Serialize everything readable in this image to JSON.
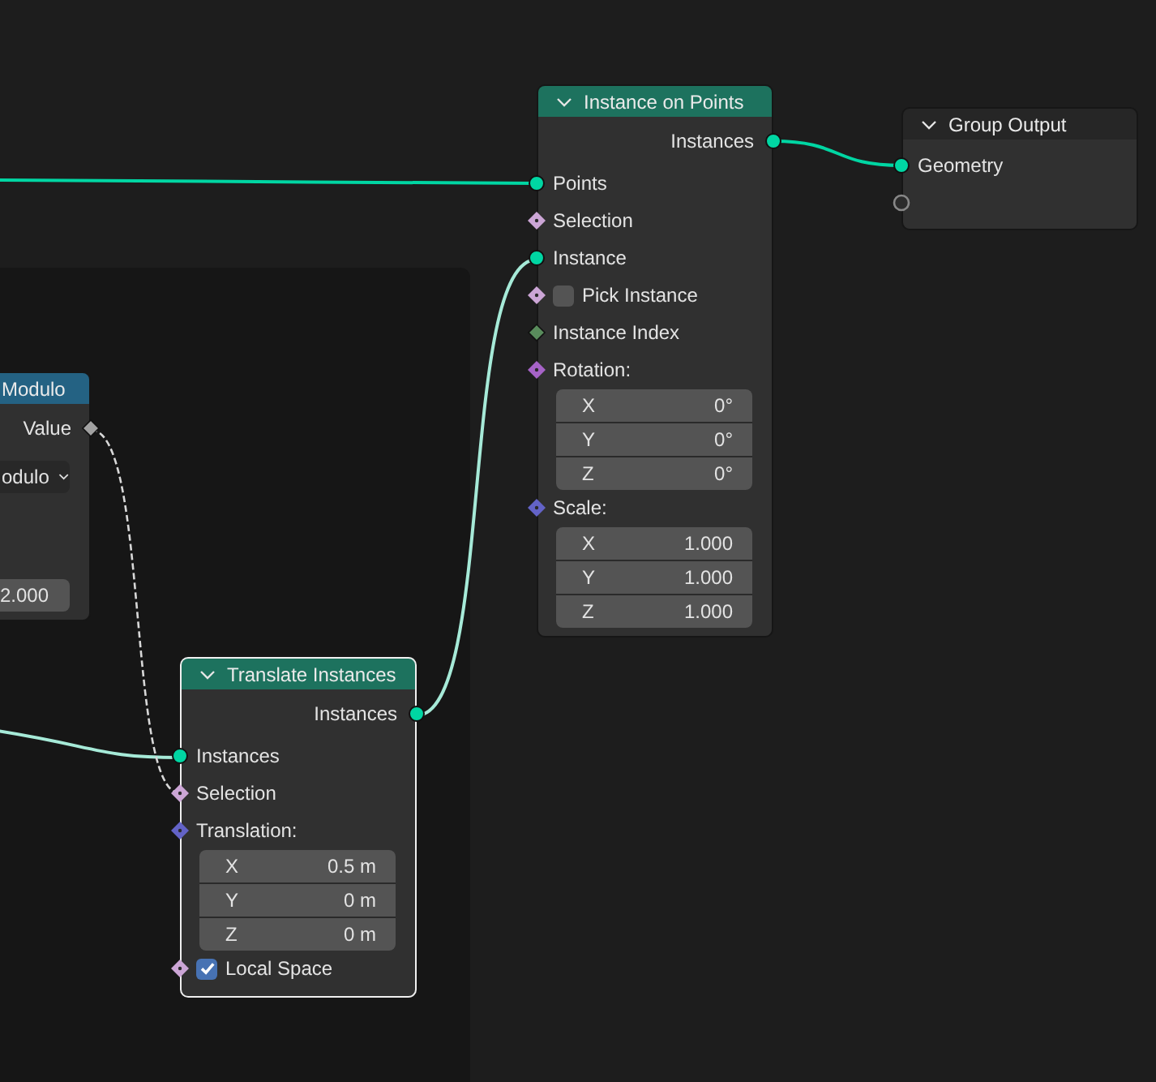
{
  "nodes": [
    {
      "title": "Instance on Points",
      "kind": "geometry",
      "selected": false,
      "rows": [
        {
          "kind": "output",
          "label": "Instances",
          "socket": {
            "kind": "circle",
            "color": "#00d6a3"
          }
        },
        {
          "kind": "input",
          "label": "Points",
          "socket": {
            "kind": "circle",
            "color": "#00d6a3"
          }
        },
        {
          "kind": "input",
          "label": "Selection",
          "socket": {
            "kind": "diamond-dot",
            "color": "#cca6d6"
          }
        },
        {
          "kind": "input",
          "label": "Instance",
          "socket": {
            "kind": "circle",
            "color": "#00d6a3"
          }
        },
        {
          "kind": "checkbox",
          "label": "Pick Instance",
          "socket": {
            "kind": "diamond-dot",
            "color": "#cca6d6"
          },
          "checked": false
        },
        {
          "kind": "input",
          "label": "Instance Index",
          "socket": {
            "kind": "diamond",
            "color": "#598c5c"
          }
        },
        {
          "kind": "vector",
          "label": "Rotation:",
          "socket": {
            "kind": "diamond-dot",
            "color": "#a663c7"
          },
          "components": [
            {
              "axis": "X",
              "value": "0°"
            },
            {
              "axis": "Y",
              "value": "0°"
            },
            {
              "axis": "Z",
              "value": "0°"
            }
          ]
        },
        {
          "kind": "vector",
          "label": "Scale:",
          "socket": {
            "kind": "diamond-dot",
            "color": "#6363c7"
          },
          "components": [
            {
              "axis": "X",
              "value": "1.000"
            },
            {
              "axis": "Y",
              "value": "1.000"
            },
            {
              "axis": "Z",
              "value": "1.000"
            }
          ]
        }
      ]
    },
    {
      "title": "Group Output",
      "kind": "output",
      "selected": false,
      "rows": [
        {
          "kind": "input",
          "label": "Geometry",
          "socket": {
            "kind": "circle",
            "color": "#00d6a3"
          }
        },
        {
          "kind": "empty",
          "socket": {
            "kind": "ring"
          }
        }
      ]
    },
    {
      "title": "Modulo",
      "kind": "math",
      "selected": false,
      "rows": [
        {
          "kind": "output",
          "label": "Value",
          "socket": {
            "kind": "diamond",
            "color": "#a1a1a1"
          }
        },
        {
          "kind": "dropdown",
          "value": "odulo"
        },
        {
          "kind": "field",
          "value": "2.000"
        }
      ]
    },
    {
      "title": "Translate Instances",
      "kind": "geometry",
      "selected": true,
      "rows": [
        {
          "kind": "output",
          "label": "Instances",
          "socket": {
            "kind": "circle",
            "color": "#00d6a3"
          }
        },
        {
          "kind": "input",
          "label": "Instances",
          "socket": {
            "kind": "circle",
            "color": "#00d6a3"
          }
        },
        {
          "kind": "input",
          "label": "Selection",
          "socket": {
            "kind": "diamond-dot",
            "color": "#cca6d6"
          }
        },
        {
          "kind": "vector",
          "label": "Translation:",
          "socket": {
            "kind": "diamond-dot",
            "color": "#6363c7"
          },
          "components": [
            {
              "axis": "X",
              "value": "0.5 m"
            },
            {
              "axis": "Y",
              "value": "0 m"
            },
            {
              "axis": "Z",
              "value": "0 m"
            }
          ]
        },
        {
          "kind": "checkbox",
          "label": "Local Space",
          "socket": {
            "kind": "diamond-dot",
            "color": "#cca6d6"
          },
          "checked": true
        }
      ]
    }
  ]
}
